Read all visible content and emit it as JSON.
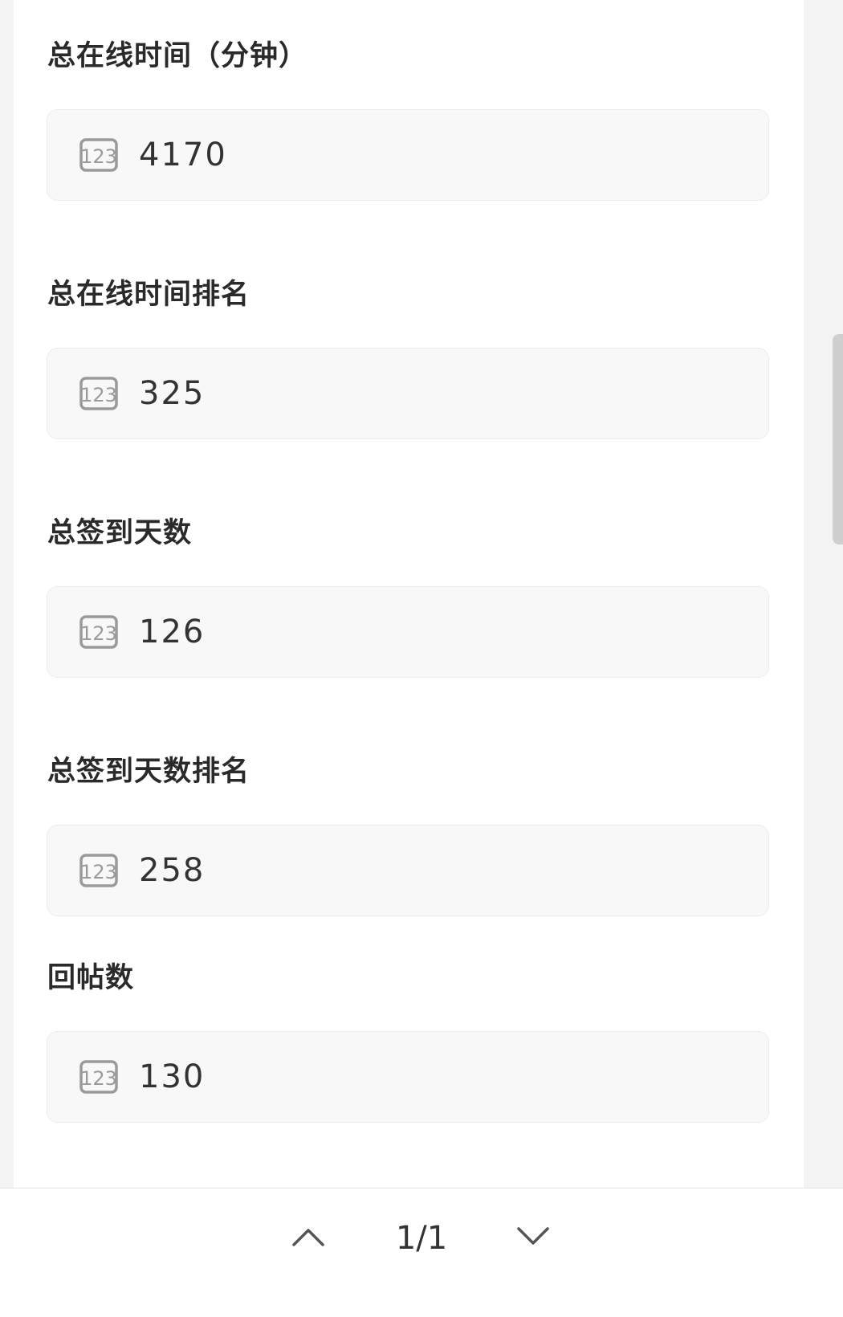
{
  "fields": [
    {
      "label": "总在线时间（分钟）",
      "value": "4170",
      "icon": "number-123-icon"
    },
    {
      "label": "总在线时间排名",
      "value": "325",
      "icon": "number-123-icon"
    },
    {
      "label": "总签到天数",
      "value": "126",
      "icon": "number-123-icon"
    },
    {
      "label": "总签到天数排名",
      "value": "258",
      "icon": "number-123-icon"
    },
    {
      "label": "回帖数",
      "value": "130",
      "icon": "number-123-icon"
    }
  ],
  "pager": {
    "indicator": "1/1",
    "prev_icon": "chevron-up-icon",
    "next_icon": "chevron-down-icon"
  },
  "colors": {
    "page_background": "#f3f3f3",
    "card_background": "#ffffff",
    "field_background": "#f8f8f8",
    "label_text": "#2a2a2a",
    "value_text": "#333333",
    "icon_stroke": "#9a9a9a"
  }
}
